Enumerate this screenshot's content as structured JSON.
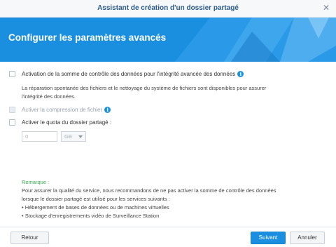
{
  "window": {
    "title": "Assistant de création d'un dossier partagé"
  },
  "banner": {
    "heading": "Configurer les paramètres avancés"
  },
  "options": {
    "checksum_label": "Activation de la somme de contrôle des données pour l'intégrité avancée des données",
    "checksum_checked": false,
    "checksum_description_line1": "La réparation spontanée des fichiers et le nettoyage du système de fichiers sont disponibles pour assurer",
    "checksum_description_line2": "l'intégrité des données.",
    "compression_label": "Activer la compression de fichier",
    "compression_enabled": false,
    "quota_label": "Activer le quota du dossier partagé :",
    "quota_checked": false,
    "quota_value": "0",
    "quota_unit": "GB"
  },
  "remark": {
    "title": "Remarque :",
    "line1": "Pour assurer la qualité du service, nous recommandons de ne pas activer la somme de contrôle des données",
    "line2": "lorsque le dossier partagé est utilisé pour les services suivants :",
    "items": [
      "Hébergement de bases de données ou de machines virtuelles",
      "Stockage d'enregistrements vidéo de Surveillance Station"
    ]
  },
  "footer": {
    "back_label": "Retour",
    "next_label": "Suivant",
    "cancel_label": "Annuler"
  },
  "icons": {
    "info": "info-icon",
    "close": "close-icon",
    "dropdown": "chevron-down-icon"
  },
  "colors": {
    "accent": "#1a8fe0",
    "remark_title": "#38a84d",
    "title_text": "#2b5c8a"
  }
}
